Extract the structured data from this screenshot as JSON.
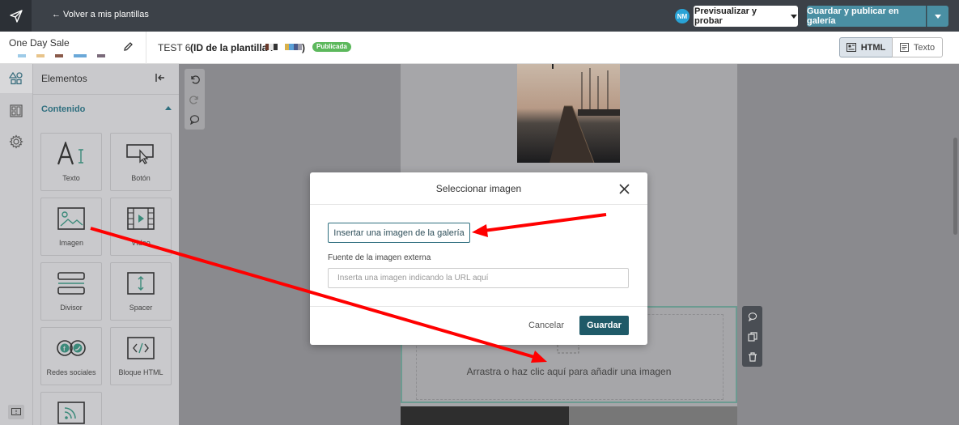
{
  "topbar": {
    "back_label": "← Volver a mis plantillas",
    "avatar_initials": "NM",
    "preview_label": "Previsualizar y probar",
    "publish_label": "Guardar y publicar en galería"
  },
  "template": {
    "name": "One Day Sale",
    "test_label": "TEST 6",
    "id_label": "(ID de la plantilla :",
    "id_close": ")",
    "status_badge": "Publicada"
  },
  "view_toggle": {
    "html_label": "HTML",
    "text_label": "Texto"
  },
  "panel": {
    "title": "Elementos",
    "section": "Contenido",
    "items": [
      {
        "label": "Texto",
        "icon": "text-icon"
      },
      {
        "label": "Botón",
        "icon": "button-icon"
      },
      {
        "label": "Imagen",
        "icon": "image-icon"
      },
      {
        "label": "Vídeo",
        "icon": "video-icon"
      },
      {
        "label": "Divisor",
        "icon": "divider-icon"
      },
      {
        "label": "Spacer",
        "icon": "spacer-icon"
      },
      {
        "label": "Redes sociales",
        "icon": "social-icon"
      },
      {
        "label": "Bloque HTML",
        "icon": "html-block-icon"
      },
      {
        "label": "",
        "icon": "rss-icon"
      }
    ]
  },
  "canvas": {
    "image_hint": "Arrastra o haz clic aquí para añadir una imagen"
  },
  "modal": {
    "title": "Seleccionar imagen",
    "gallery_button": "Insertar una imagen de la galería",
    "external_label": "Fuente de la imagen externa",
    "url_placeholder": "Inserta una imagen indicando la URL aquí",
    "url_value": "",
    "cancel_label": "Cancelar",
    "save_label": "Guardar"
  },
  "colors": {
    "accent": "#1f5a68",
    "annotation_arrow": "#ff0000",
    "badge": "#5cb85c"
  }
}
